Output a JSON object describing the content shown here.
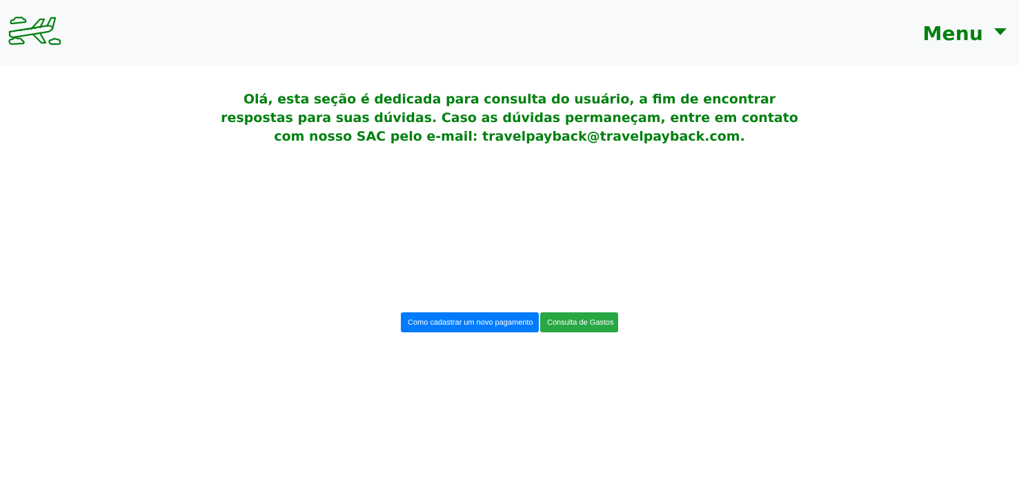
{
  "navbar": {
    "logo_icon": "airplane-with-clouds-icon",
    "menu_label": "Menu",
    "menu_caret_icon": "caret-down-icon",
    "accent_color": "#00800f",
    "background_color": "#f8f9fa"
  },
  "main": {
    "intro_text": "Olá, esta seção é dedicada para consulta do usuário, a fim de encontrar respostas para suas dúvidas. Caso as dúvidas permaneçam, entre em contato com nosso SAC pelo e-mail: travelpayback@travelpayback.com."
  },
  "actions": {
    "register_payment_label": "Como cadastrar um novo pagamento",
    "register_payment_color": "#007bff",
    "expense_query_label": "Consulta de Gastos",
    "expense_query_color": "#28a745"
  }
}
